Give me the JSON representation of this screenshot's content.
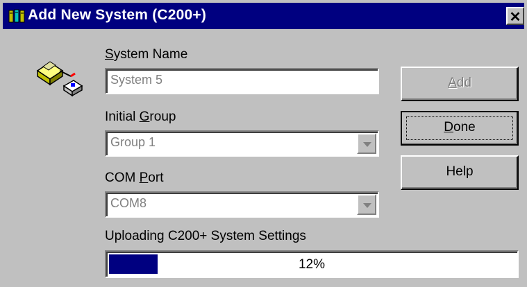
{
  "window": {
    "title": "Add New System (C200+)",
    "close_glyph": "✕"
  },
  "icons": {
    "app_icon": "system-book-icon",
    "system_icon": "computer-with-connector-icon"
  },
  "form": {
    "system_name": {
      "label_pre": "",
      "label_key": "S",
      "label_post": "ystem Name",
      "value": "System 5"
    },
    "initial_group": {
      "label_pre": "Initial ",
      "label_key": "G",
      "label_post": "roup",
      "value": "Group 1"
    },
    "com_port": {
      "label_pre": "COM ",
      "label_key": "P",
      "label_post": "ort",
      "value": "COM8"
    }
  },
  "buttons": {
    "add": {
      "key": "A",
      "post": "dd"
    },
    "done": {
      "key": "D",
      "post": "one"
    },
    "help": {
      "label": "Help"
    }
  },
  "progress": {
    "caption": "Uploading C200+ System Settings",
    "percent_text": "12%",
    "fraction": 0.12
  },
  "colors": {
    "titlebar": "#000080",
    "progress_fill": "#000080",
    "dialog_bg": "#c0c0c0"
  }
}
